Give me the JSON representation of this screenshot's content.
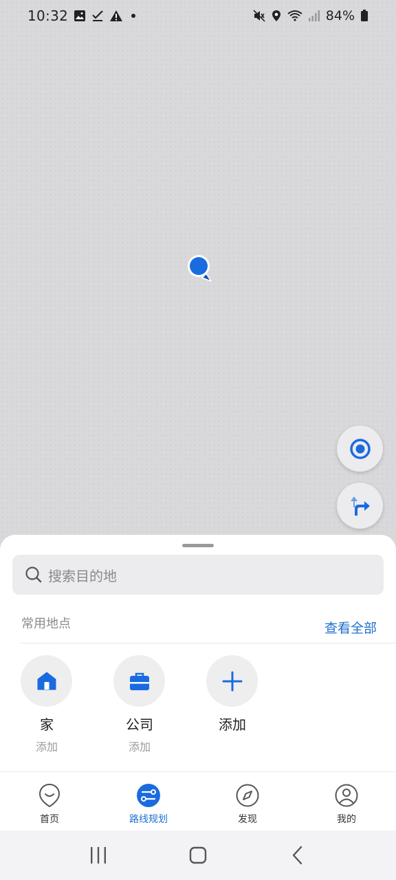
{
  "status_bar": {
    "time": "10:32",
    "battery": "84%",
    "left_icons": [
      "image-icon",
      "check-icon",
      "warning-icon",
      "dot-icon"
    ],
    "right_icons": [
      "mute-icon",
      "location-icon",
      "wifi-icon",
      "signal-icon",
      "battery-icon"
    ]
  },
  "map": {
    "controls": [
      "locate-button",
      "route-button"
    ]
  },
  "sheet": {
    "search_placeholder": "搜索目的地",
    "frequent_title": "常用地点",
    "view_all": "查看全部",
    "places": [
      {
        "name": "家",
        "sub": "添加",
        "icon": "home-icon"
      },
      {
        "name": "公司",
        "sub": "添加",
        "icon": "briefcase-icon"
      },
      {
        "name": "添加",
        "sub": "",
        "icon": "plus-icon"
      }
    ]
  },
  "bottom_nav": {
    "items": [
      {
        "label": "首页",
        "icon": "home-smile-icon",
        "active": false
      },
      {
        "label": "路线规划",
        "icon": "route-plan-icon",
        "active": true
      },
      {
        "label": "发现",
        "icon": "compass-icon",
        "active": false
      },
      {
        "label": "我的",
        "icon": "profile-icon",
        "active": false
      }
    ]
  },
  "colors": {
    "accent": "#1f6fd0",
    "marker": "#1a6be0",
    "map_bg": "#d9d9dc",
    "sheet_bg": "#ffffff"
  }
}
